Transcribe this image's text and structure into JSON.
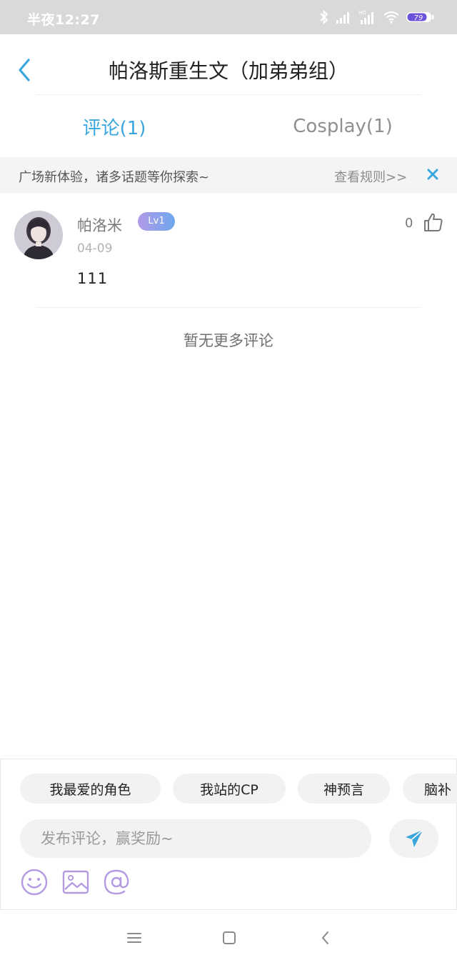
{
  "status_bar": {
    "time": "半夜12:27",
    "battery": "79",
    "icons": [
      "bluetooth-icon",
      "signal-icon",
      "hd-signal-icon",
      "wifi-icon",
      "battery-icon"
    ]
  },
  "header": {
    "title": "帕洛斯重生文（加弟弟组）",
    "back_icon": "chevron-left-icon"
  },
  "tabs": [
    {
      "label": "评论(1)",
      "active": true
    },
    {
      "label": "Cosplay(1)",
      "active": false
    }
  ],
  "notice": {
    "text": "广场新体验，诸多话题等你探索~",
    "link": "查看规则>>",
    "close_icon": "close-icon"
  },
  "comments": [
    {
      "username": "帕洛米",
      "level": "Lv1",
      "date": "04-09",
      "body": "111",
      "likes": "0"
    }
  ],
  "no_more_text": "暂无更多评论",
  "composer": {
    "topics": [
      "我最爱的角色",
      "我站的CP",
      "神预言",
      "脑补"
    ],
    "placeholder": "发布评论，赢奖励~",
    "tools": [
      "emoji-icon",
      "image-icon",
      "at-icon"
    ],
    "send_icon": "send-icon"
  },
  "colors": {
    "accent": "#3aa6de",
    "tool_purple": "#b49ae0",
    "badge_start": "#b29ae8",
    "badge_end": "#6fa7ee"
  }
}
